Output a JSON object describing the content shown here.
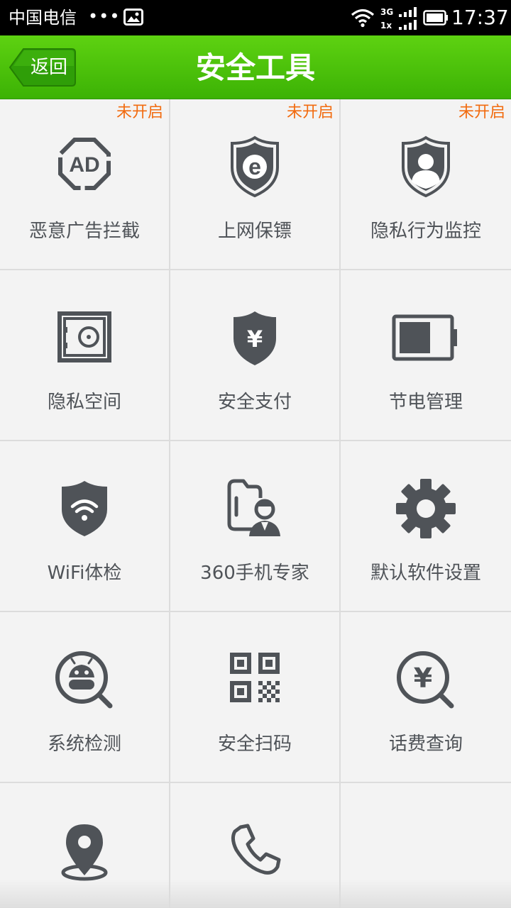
{
  "status_bar": {
    "carrier": "中国电信",
    "dots": "•••",
    "network_top": "3G",
    "network_bottom": "1x",
    "time": "17:37"
  },
  "header": {
    "back_label": "返回",
    "title": "安全工具"
  },
  "colors": {
    "header_green": "#4cc30a",
    "badge_orange": "#f26b0f",
    "icon_gray": "#4f5358"
  },
  "tools": [
    {
      "label": "恶意广告拦截",
      "badge": "未开启",
      "icon": "ad-block-icon"
    },
    {
      "label": "上网保镖",
      "badge": "未开启",
      "icon": "browser-shield-icon"
    },
    {
      "label": "隐私行为监控",
      "badge": "未开启",
      "icon": "privacy-monitor-icon"
    },
    {
      "label": "隐私空间",
      "badge": "",
      "icon": "safe-box-icon"
    },
    {
      "label": "安全支付",
      "badge": "",
      "icon": "payment-shield-icon"
    },
    {
      "label": "节电管理",
      "badge": "",
      "icon": "battery-icon"
    },
    {
      "label": "WiFi体检",
      "badge": "",
      "icon": "wifi-shield-icon"
    },
    {
      "label": "360手机专家",
      "badge": "",
      "icon": "phone-expert-icon"
    },
    {
      "label": "默认软件设置",
      "badge": "",
      "icon": "gear-icon"
    },
    {
      "label": "系统检测",
      "badge": "",
      "icon": "android-scan-icon"
    },
    {
      "label": "安全扫码",
      "badge": "",
      "icon": "qr-code-icon"
    },
    {
      "label": "话费查询",
      "badge": "",
      "icon": "fee-query-icon"
    },
    {
      "label": "",
      "badge": "",
      "icon": "location-pin-icon"
    },
    {
      "label": "",
      "badge": "",
      "icon": "phone-icon"
    }
  ]
}
